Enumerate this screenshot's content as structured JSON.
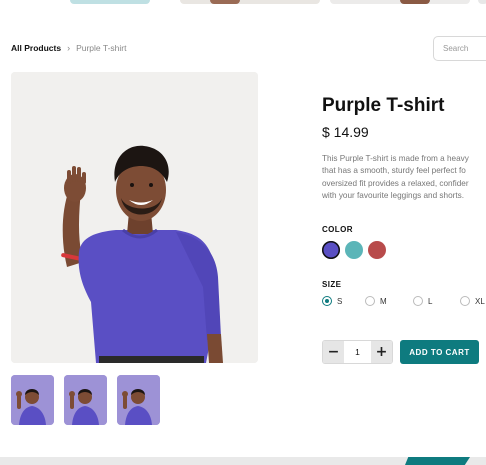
{
  "breadcrumb": {
    "root": "All Products",
    "current": "Purple T-shirt"
  },
  "search": {
    "placeholder": "Search"
  },
  "product": {
    "title": "Purple T-shirt",
    "price": "$ 14.99",
    "description_lines": [
      "This Purple T-shirt is made from a heavy",
      "that has a smooth, sturdy feel perfect fo",
      "oversized fit provides a relaxed, confider",
      "with your favourite leggings and shorts."
    ]
  },
  "color": {
    "label": "COLOR",
    "options": [
      {
        "name": "purple",
        "hex": "#5a4fc4",
        "selected": true
      },
      {
        "name": "teal",
        "hex": "#5bb5b8",
        "selected": false
      },
      {
        "name": "red",
        "hex": "#b84b4b",
        "selected": false
      }
    ]
  },
  "size": {
    "label": "SIZE",
    "options": [
      {
        "label": "S",
        "selected": true
      },
      {
        "label": "M",
        "selected": false
      },
      {
        "label": "L",
        "selected": false
      },
      {
        "label": "XL",
        "selected": false
      }
    ]
  },
  "quantity": {
    "value": "1",
    "decrement": "−",
    "increment": "+"
  },
  "cart": {
    "label": "ADD TO CART"
  },
  "colors": {
    "accent": "#0e7b7f",
    "shirt": "#5a4fc4"
  }
}
